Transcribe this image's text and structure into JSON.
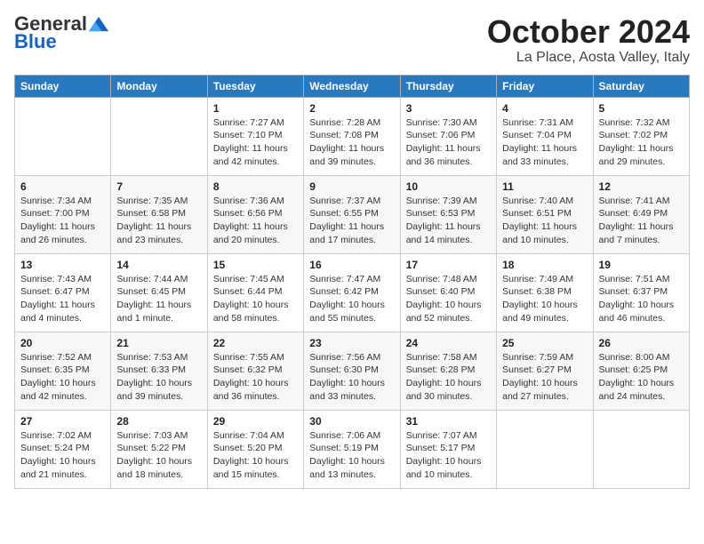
{
  "header": {
    "logo_general": "General",
    "logo_blue": "Blue",
    "month_title": "October 2024",
    "location": "La Place, Aosta Valley, Italy"
  },
  "days_of_week": [
    "Sunday",
    "Monday",
    "Tuesday",
    "Wednesday",
    "Thursday",
    "Friday",
    "Saturday"
  ],
  "weeks": [
    [
      {
        "day": "",
        "info": ""
      },
      {
        "day": "",
        "info": ""
      },
      {
        "day": "1",
        "info": "Sunrise: 7:27 AM\nSunset: 7:10 PM\nDaylight: 11 hours and 42 minutes."
      },
      {
        "day": "2",
        "info": "Sunrise: 7:28 AM\nSunset: 7:08 PM\nDaylight: 11 hours and 39 minutes."
      },
      {
        "day": "3",
        "info": "Sunrise: 7:30 AM\nSunset: 7:06 PM\nDaylight: 11 hours and 36 minutes."
      },
      {
        "day": "4",
        "info": "Sunrise: 7:31 AM\nSunset: 7:04 PM\nDaylight: 11 hours and 33 minutes."
      },
      {
        "day": "5",
        "info": "Sunrise: 7:32 AM\nSunset: 7:02 PM\nDaylight: 11 hours and 29 minutes."
      }
    ],
    [
      {
        "day": "6",
        "info": "Sunrise: 7:34 AM\nSunset: 7:00 PM\nDaylight: 11 hours and 26 minutes."
      },
      {
        "day": "7",
        "info": "Sunrise: 7:35 AM\nSunset: 6:58 PM\nDaylight: 11 hours and 23 minutes."
      },
      {
        "day": "8",
        "info": "Sunrise: 7:36 AM\nSunset: 6:56 PM\nDaylight: 11 hours and 20 minutes."
      },
      {
        "day": "9",
        "info": "Sunrise: 7:37 AM\nSunset: 6:55 PM\nDaylight: 11 hours and 17 minutes."
      },
      {
        "day": "10",
        "info": "Sunrise: 7:39 AM\nSunset: 6:53 PM\nDaylight: 11 hours and 14 minutes."
      },
      {
        "day": "11",
        "info": "Sunrise: 7:40 AM\nSunset: 6:51 PM\nDaylight: 11 hours and 10 minutes."
      },
      {
        "day": "12",
        "info": "Sunrise: 7:41 AM\nSunset: 6:49 PM\nDaylight: 11 hours and 7 minutes."
      }
    ],
    [
      {
        "day": "13",
        "info": "Sunrise: 7:43 AM\nSunset: 6:47 PM\nDaylight: 11 hours and 4 minutes."
      },
      {
        "day": "14",
        "info": "Sunrise: 7:44 AM\nSunset: 6:45 PM\nDaylight: 11 hours and 1 minute."
      },
      {
        "day": "15",
        "info": "Sunrise: 7:45 AM\nSunset: 6:44 PM\nDaylight: 10 hours and 58 minutes."
      },
      {
        "day": "16",
        "info": "Sunrise: 7:47 AM\nSunset: 6:42 PM\nDaylight: 10 hours and 55 minutes."
      },
      {
        "day": "17",
        "info": "Sunrise: 7:48 AM\nSunset: 6:40 PM\nDaylight: 10 hours and 52 minutes."
      },
      {
        "day": "18",
        "info": "Sunrise: 7:49 AM\nSunset: 6:38 PM\nDaylight: 10 hours and 49 minutes."
      },
      {
        "day": "19",
        "info": "Sunrise: 7:51 AM\nSunset: 6:37 PM\nDaylight: 10 hours and 46 minutes."
      }
    ],
    [
      {
        "day": "20",
        "info": "Sunrise: 7:52 AM\nSunset: 6:35 PM\nDaylight: 10 hours and 42 minutes."
      },
      {
        "day": "21",
        "info": "Sunrise: 7:53 AM\nSunset: 6:33 PM\nDaylight: 10 hours and 39 minutes."
      },
      {
        "day": "22",
        "info": "Sunrise: 7:55 AM\nSunset: 6:32 PM\nDaylight: 10 hours and 36 minutes."
      },
      {
        "day": "23",
        "info": "Sunrise: 7:56 AM\nSunset: 6:30 PM\nDaylight: 10 hours and 33 minutes."
      },
      {
        "day": "24",
        "info": "Sunrise: 7:58 AM\nSunset: 6:28 PM\nDaylight: 10 hours and 30 minutes."
      },
      {
        "day": "25",
        "info": "Sunrise: 7:59 AM\nSunset: 6:27 PM\nDaylight: 10 hours and 27 minutes."
      },
      {
        "day": "26",
        "info": "Sunrise: 8:00 AM\nSunset: 6:25 PM\nDaylight: 10 hours and 24 minutes."
      }
    ],
    [
      {
        "day": "27",
        "info": "Sunrise: 7:02 AM\nSunset: 5:24 PM\nDaylight: 10 hours and 21 minutes."
      },
      {
        "day": "28",
        "info": "Sunrise: 7:03 AM\nSunset: 5:22 PM\nDaylight: 10 hours and 18 minutes."
      },
      {
        "day": "29",
        "info": "Sunrise: 7:04 AM\nSunset: 5:20 PM\nDaylight: 10 hours and 15 minutes."
      },
      {
        "day": "30",
        "info": "Sunrise: 7:06 AM\nSunset: 5:19 PM\nDaylight: 10 hours and 13 minutes."
      },
      {
        "day": "31",
        "info": "Sunrise: 7:07 AM\nSunset: 5:17 PM\nDaylight: 10 hours and 10 minutes."
      },
      {
        "day": "",
        "info": ""
      },
      {
        "day": "",
        "info": ""
      }
    ]
  ]
}
